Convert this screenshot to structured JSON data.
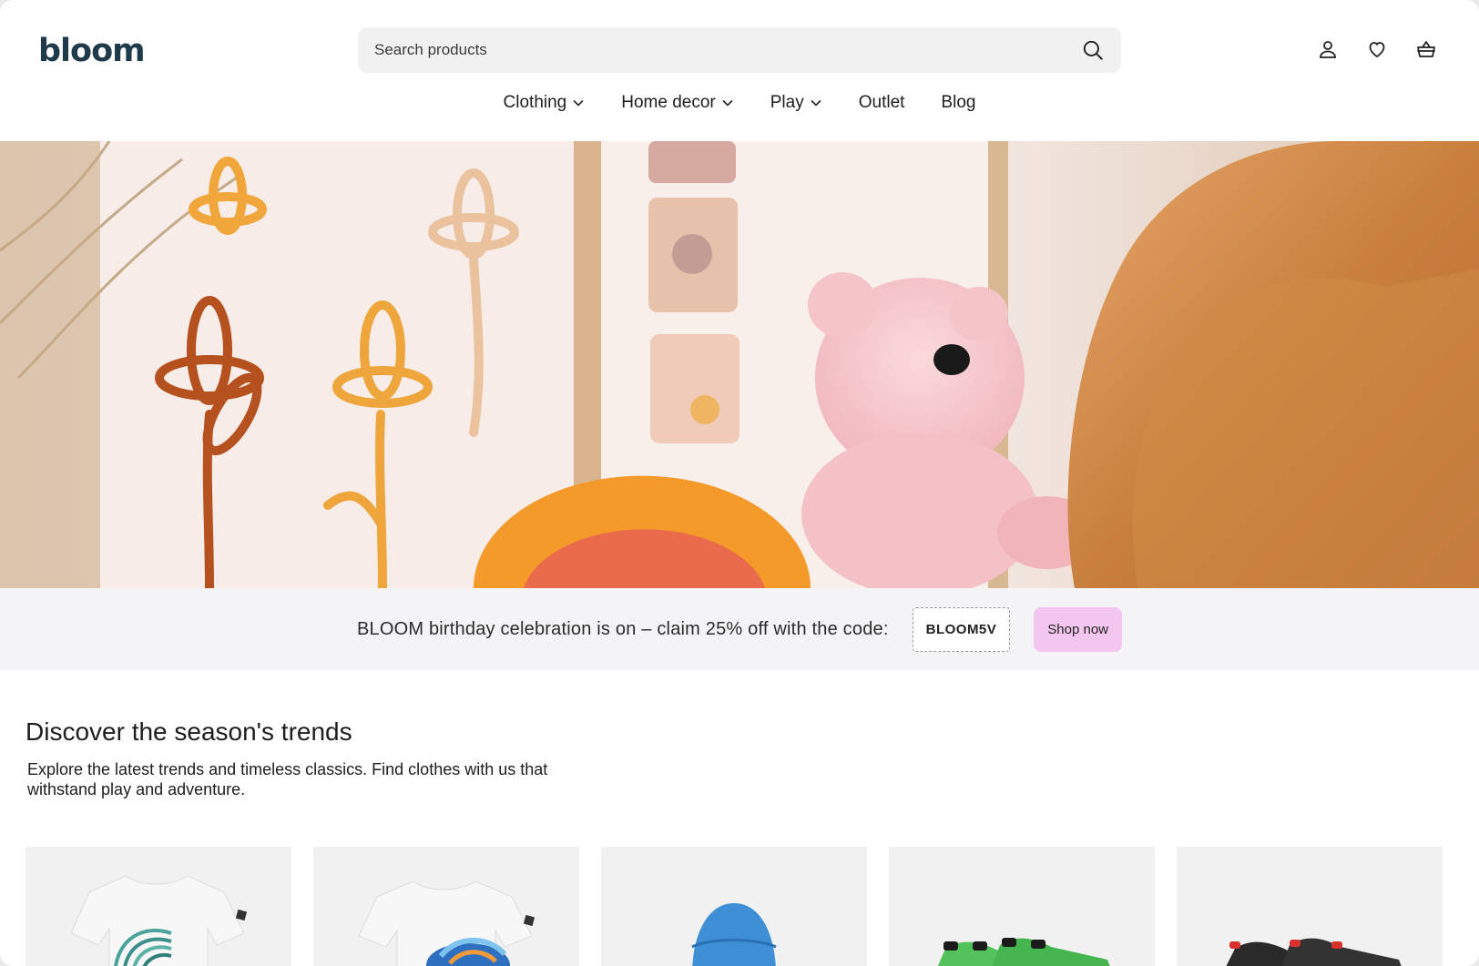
{
  "brand": {
    "logo": "bloom"
  },
  "search": {
    "placeholder": "Search products"
  },
  "header_icons": [
    "account-icon",
    "wishlist-heart-icon",
    "basket-icon"
  ],
  "nav": {
    "items": [
      {
        "label": "Clothing",
        "has_dropdown": true
      },
      {
        "label": "Home decor",
        "has_dropdown": true
      },
      {
        "label": "Play",
        "has_dropdown": true
      },
      {
        "label": "Outlet",
        "has_dropdown": false
      },
      {
        "label": "Blog",
        "has_dropdown": false
      }
    ]
  },
  "promo": {
    "text": "BLOOM birthday celebration is on – claim 25% off with the code:",
    "code": "BLOOM5V",
    "cta": "Shop now"
  },
  "trends": {
    "title": "Discover the season's trends",
    "description": "Explore the latest trends and timeless classics. Find clothes with us that withstand play and adventure."
  },
  "products": [
    {
      "image": "white-tshirt-rainbow-print"
    },
    {
      "image": "white-tshirt-wave-print"
    },
    {
      "image": "blue-bucket-hat"
    },
    {
      "image": "green-sneakers"
    },
    {
      "image": "black-sneakers"
    }
  ],
  "colors": {
    "promo_bg": "#f4f4f6",
    "cta_bg": "#f3c6ef",
    "logo": "#1f3a4a"
  }
}
